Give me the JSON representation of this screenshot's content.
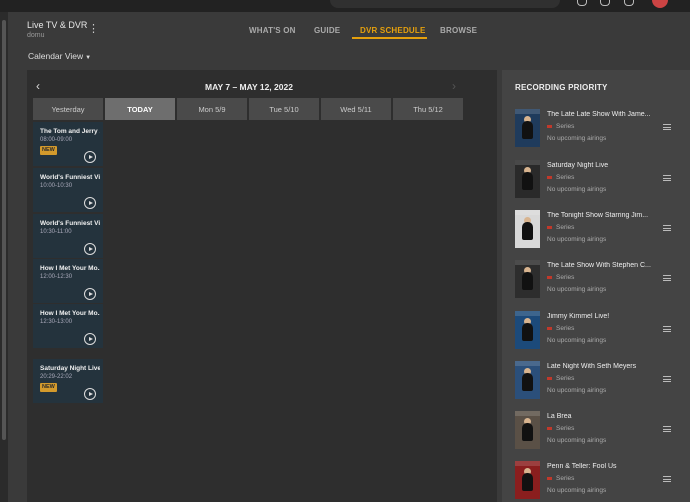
{
  "app": {
    "title": "Live TV & DVR",
    "server": "domu"
  },
  "nav": {
    "tabs": [
      {
        "label": "WHAT'S ON",
        "active": false
      },
      {
        "label": "GUIDE",
        "active": false
      },
      {
        "label": "DVR SCHEDULE",
        "active": true
      },
      {
        "label": "BROWSE",
        "active": false
      }
    ]
  },
  "calendar": {
    "view_label": "Calendar View",
    "date_range": "MAY 7 – MAY 12, 2022",
    "days": [
      {
        "label": "Yesterday",
        "active": false
      },
      {
        "label": "TODAY",
        "active": true
      },
      {
        "label": "Mon 5/9",
        "active": false
      },
      {
        "label": "Tue 5/10",
        "active": false
      },
      {
        "label": "Wed 5/11",
        "active": false
      },
      {
        "label": "Thu 5/12",
        "active": false
      }
    ],
    "recordings": [
      {
        "title": "The Tom and Jerry ...",
        "time": "08:00-09:00",
        "badge": "NEW"
      },
      {
        "title": "World's Funniest Vi...",
        "time": "10:00-10:30",
        "badge": ""
      },
      {
        "title": "World's Funniest Vi...",
        "time": "10:30-11:00",
        "badge": ""
      },
      {
        "title": "How I Met Your Mo...",
        "time": "12:00-12:30",
        "badge": ""
      },
      {
        "title": "How I Met Your Mo...",
        "time": "12:30-13:00",
        "badge": ""
      },
      {
        "title": "Saturday Night Live",
        "time": "20:29-22:02",
        "badge": "NEW"
      }
    ]
  },
  "priority": {
    "title": "RECORDING PRIORITY",
    "items": [
      {
        "name": "The Late Late Show With Jame...",
        "type": "Series",
        "airings": "No upcoming airings"
      },
      {
        "name": "Saturday Night Live",
        "type": "Series",
        "airings": "No upcoming airings"
      },
      {
        "name": "The Tonight Show Starring Jim...",
        "type": "Series",
        "airings": "No upcoming airings"
      },
      {
        "name": "The Late Show With Stephen C...",
        "type": "Series",
        "airings": "No upcoming airings"
      },
      {
        "name": "Jimmy Kimmel Live!",
        "type": "Series",
        "airings": "No upcoming airings"
      },
      {
        "name": "Late Night With Seth Meyers",
        "type": "Series",
        "airings": "No upcoming airings"
      },
      {
        "name": "La Brea",
        "type": "Series",
        "airings": "No upcoming airings"
      },
      {
        "name": "Penn & Teller: Fool Us",
        "type": "Series",
        "airings": "No upcoming airings"
      }
    ]
  },
  "colors": {
    "accent": "#e5a00d",
    "new_badge": "#d39a2c",
    "card": "#24333d"
  }
}
